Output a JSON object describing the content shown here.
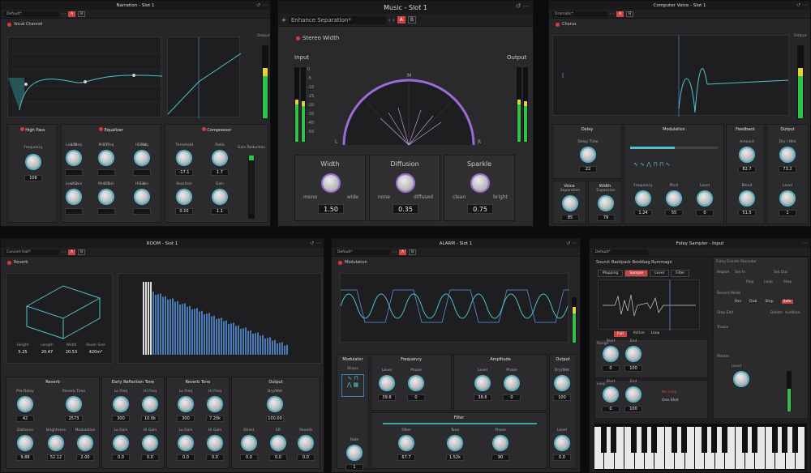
{
  "narration": {
    "title": "Narration - Slot 1",
    "preset": "Default*",
    "plugin": "Vocal Channel",
    "output": "Output",
    "sections": {
      "hp": "High Pass",
      "eq": "Equalizer",
      "comp": "Compressor"
    },
    "hp_freq": "Frequency",
    "hp_freq_val": "106",
    "eq": [
      {
        "l": "Low Freq",
        "v": "118"
      },
      {
        "l": "Mid Freq",
        "v": "557"
      },
      {
        "l": "Hi Freq",
        "v": "5304"
      },
      {
        "l": "Low Gain",
        "v": "-0.2"
      },
      {
        "l": "Mid Gain",
        "v": "-2.6"
      },
      {
        "l": "Hi Gain",
        "v": "1.4"
      }
    ],
    "comp": [
      {
        "l": "Threshold",
        "v": "-17.1"
      },
      {
        "l": "Ratio",
        "v": "1.7"
      },
      {
        "l": "Reaction",
        "v": "0.10"
      },
      {
        "l": "Gain",
        "v": "1.1"
      }
    ],
    "gainred": "Gain Reduction"
  },
  "music": {
    "title": "Music - Slot 1",
    "preset": "Enhance Separation*",
    "plugin": "Stereo Width",
    "input": "Input",
    "output": "Output",
    "params": [
      {
        "l": "Width",
        "min": "mono",
        "max": "wide",
        "v": "1.50"
      },
      {
        "l": "Diffusion",
        "min": "none",
        "max": "diffused",
        "v": "0.35"
      },
      {
        "l": "Sparkle",
        "min": "clean",
        "max": "bright",
        "v": "0.75"
      }
    ],
    "scale": [
      "0",
      "-5",
      "-10",
      "-15",
      "-20",
      "-30",
      "-40",
      "-50"
    ],
    "arc_l": "L",
    "arc_m": "M",
    "arc_r": "R"
  },
  "cv": {
    "title": "Computer Voice - Slot 1",
    "preset": "Dramatic*",
    "plugin": "Chorus",
    "output": "Output",
    "delay": "Delay",
    "delay_time": "Delay Time",
    "delay_val": "22",
    "mod": "Modulation",
    "feedback": "Feedback",
    "amount": "Amount",
    "amount_val": "82.7",
    "out": "Output",
    "drywet": "Dry / Wet",
    "drywet_val": "73.2",
    "voice": "Voice",
    "sep": "Separation",
    "sep_val": "85",
    "width": "Width",
    "exp": "Expansion",
    "exp_val": "79",
    "freq": "Frequency",
    "freq_val": "1.24",
    "pitch": "Pitch",
    "pitch_val": "55",
    "level": "Level",
    "level_val": "0",
    "blend": "Blend",
    "blend_val": "51.5",
    "olevel": "Level",
    "olevel_val": "1"
  },
  "room": {
    "title": "ROOM - Slot 1",
    "preset": "Concert Hall*",
    "plugin": "Reverb",
    "dims": [
      {
        "l": "Height",
        "v": "5.25"
      },
      {
        "l": "Length",
        "v": "20.47"
      },
      {
        "l": "Width",
        "v": "20.53"
      },
      {
        "l": "Room Size",
        "v": "420m³"
      }
    ],
    "reverb": "Reverb",
    "predelay": "Pre-Delay",
    "predelay_v": "42",
    "revtime": "Reverb Time",
    "revtime_v": "2573",
    "erl": "Early Reflection Tone",
    "lofreq": "Lo Freq",
    "lofreq_v": "300",
    "hifreq": "Hi Freq",
    "hifreq_v": "10.0k",
    "rtone": "Reverb Tone",
    "rlofreq_v": "300",
    "rhifreq_v": "7.20k",
    "out": "Output",
    "drywet": "Dry/Wet",
    "drywet_v": "100.00",
    "distance": "Distance",
    "distance_v": "9.88",
    "bright": "Brightness",
    "bright_v": "52.12",
    "modul": "Modulation",
    "modul_v": "2.00",
    "logain": "Lo Gain",
    "higain": "Hi Gain",
    "g0": "0.0",
    "direct": "Direct",
    "er": "ER",
    "rev": "Reverb",
    "d_v": "0.0",
    "er_v": "0.0",
    "rev_v": "0.0"
  },
  "alarm": {
    "title": "ALARM - Slot 1",
    "preset": "Default*",
    "plugin": "Modulation",
    "modulator": "Modulator",
    "shape": "Shape",
    "rate": "Rate",
    "rate_v": "1",
    "freq": "Frequency",
    "amp": "Amplitude",
    "out": "Output",
    "level": "Level",
    "phase": "Phase",
    "f_level_v": "39.8",
    "f_phase_v": "0",
    "a_level_v": "38.6",
    "a_phase_v": "0",
    "drywet": "Dry/Wet",
    "drywet_v": "100",
    "filter": "Filter",
    "flt": "Filter",
    "flt_v": "67.7",
    "tone": "Tone",
    "tone_v": "1.52k",
    "fphase": "Phase",
    "fphase_v": "90",
    "olevel": "Level",
    "olevel_v": "0.0"
  },
  "foley": {
    "title": "Foley Sampler - Input",
    "preset": "Default*",
    "sound": "Sound:",
    "sound_name": "Backpack Bookbag Rummage",
    "tabs": [
      "Mapping",
      "Sample",
      "Level",
      "Filter"
    ],
    "events": "Foley Events Recorder",
    "region": "Region",
    "setin": "Set In",
    "setout": "Set Out",
    "play": "Play",
    "loop": "Loop",
    "stop": "Stop",
    "recmode": "Record Mode",
    "rec": "Rec",
    "dub": "Dub",
    "step": "Step",
    "safe": "Safe",
    "stepedit": "Step Edit",
    "delete": "Delete",
    "audition": "Audition",
    "tracks": "Tracks",
    "mute": "Mute",
    "master": "Master",
    "level": "Level",
    "range": "Range",
    "start": "Start",
    "end": "End",
    "loopl": "Loop",
    "noloop": "No Loop",
    "oneshot": "One Shot",
    "full": "Full",
    "active": "Active",
    "loopbtn": "Loop",
    "r_start": "0",
    "r_end": "100",
    "l_start": "0",
    "l_end": "100"
  }
}
